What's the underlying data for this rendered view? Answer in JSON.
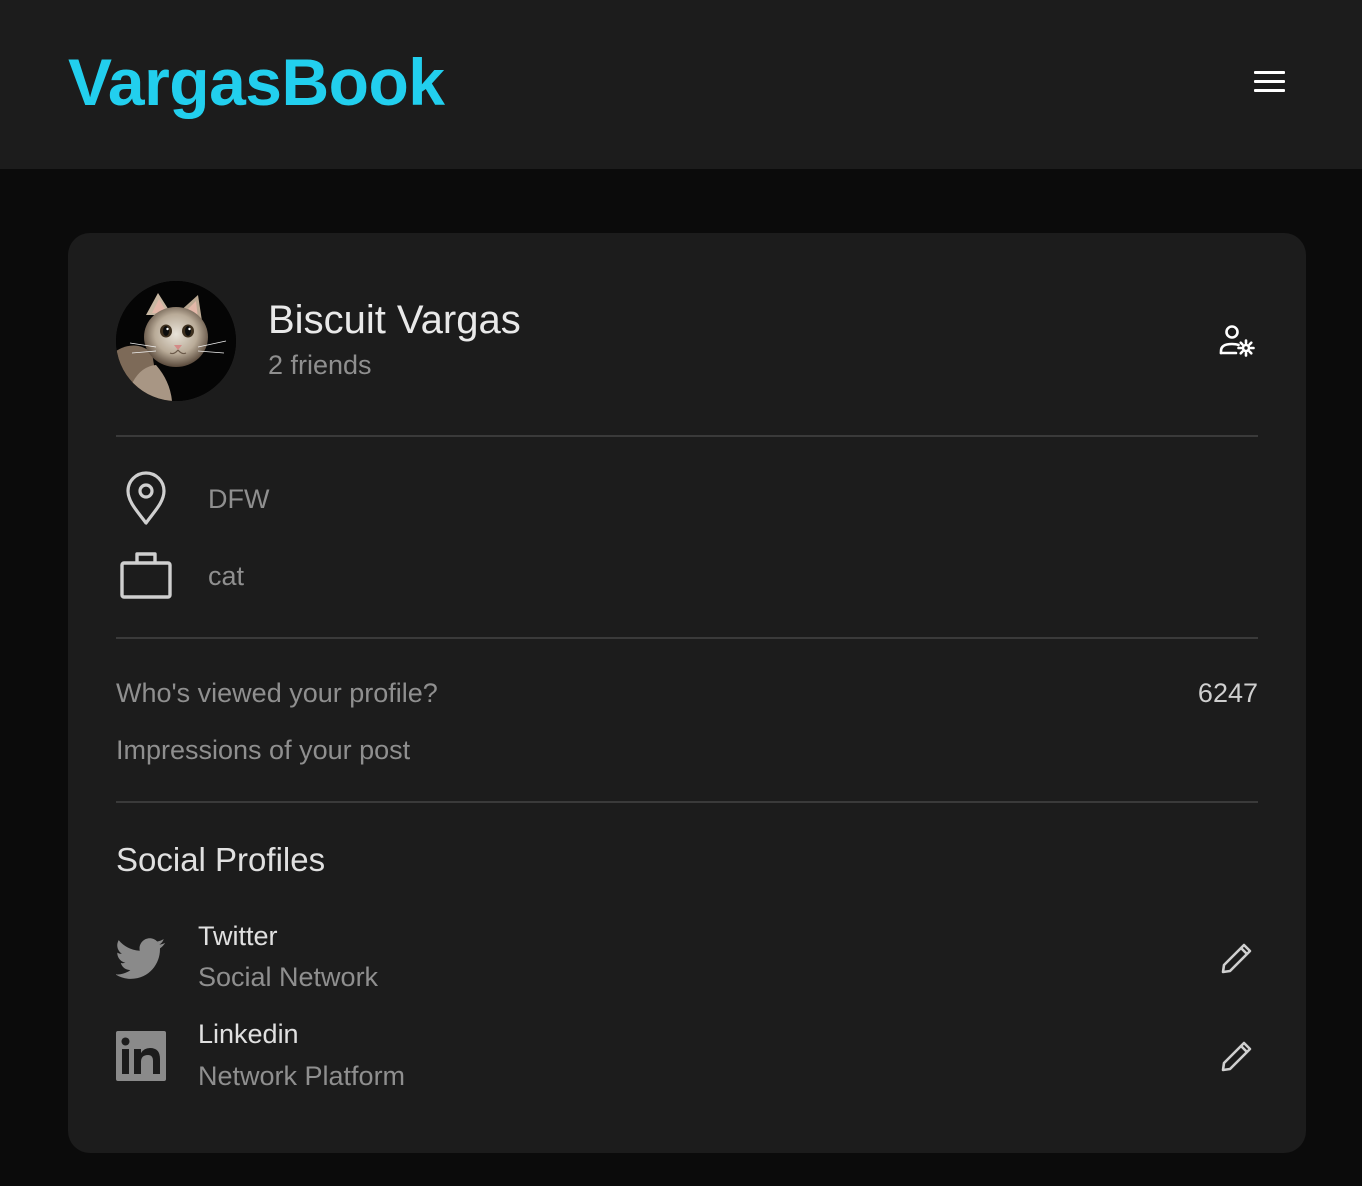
{
  "app": {
    "brand": "VargasBook",
    "brand_color": "#22cfee",
    "menu_icon": "hamburger-menu-icon"
  },
  "profile": {
    "name": "Biscuit Vargas",
    "friends": "2 friends",
    "avatar_icon": "cat-avatar",
    "manage_icon": "user-settings-icon"
  },
  "info": {
    "location": "DFW",
    "location_icon": "location-pin-icon",
    "occupation": "cat",
    "occupation_icon": "briefcase-icon"
  },
  "stats": {
    "views_label": "Who's viewed your profile?",
    "views_value": "6247",
    "impressions_label": "Impressions of your post"
  },
  "social": {
    "title": "Social Profiles",
    "items": [
      {
        "name": "Twitter",
        "subtitle": "Social Network",
        "icon": "twitter-icon",
        "edit_icon": "pencil-icon"
      },
      {
        "name": "Linkedin",
        "subtitle": "Network Platform",
        "icon": "linkedin-icon",
        "edit_icon": "pencil-icon"
      }
    ]
  }
}
